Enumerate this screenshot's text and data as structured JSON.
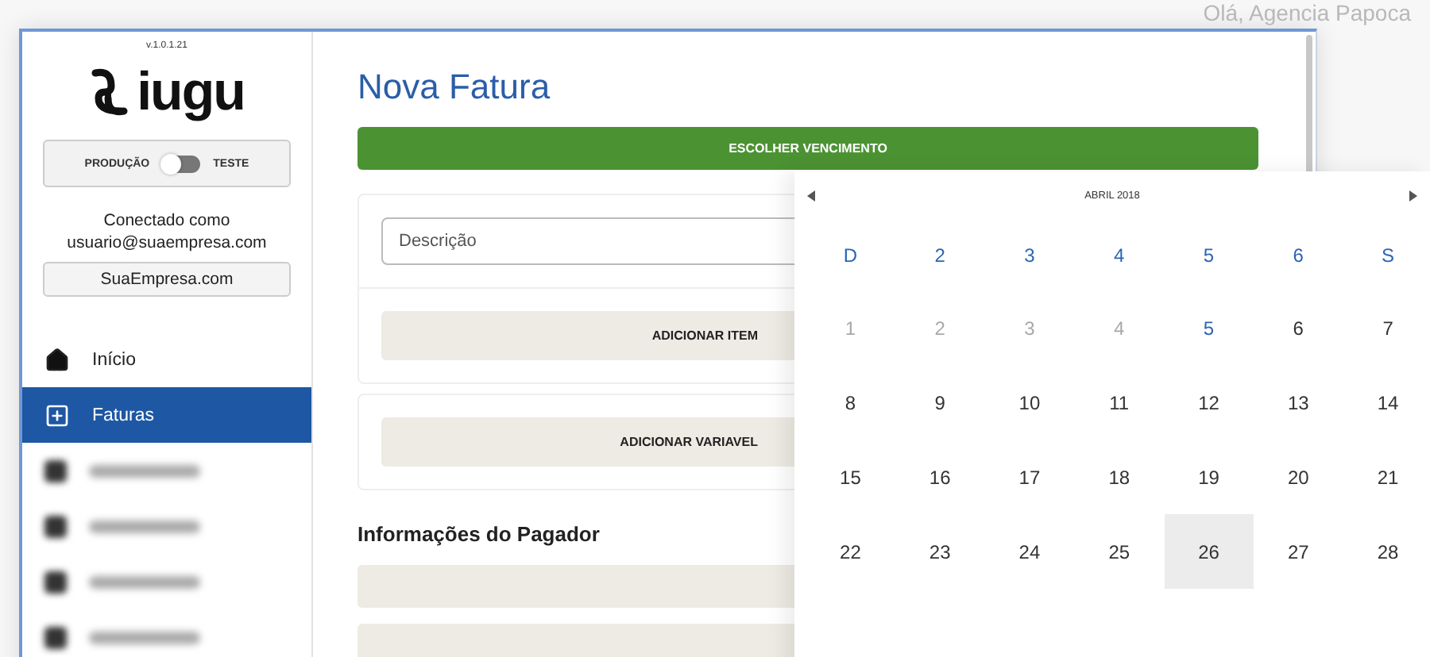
{
  "greeting": "Olá, Agencia Papoca",
  "sidebar": {
    "version": "v.1.0.1.21",
    "logo": "iugu",
    "mode_toggle": {
      "left_label": "PRODUÇÃO",
      "right_label": "TESTE",
      "on": false
    },
    "connected_label": "Conectado como",
    "email": "usuario@suaempresa.com",
    "company": "SuaEmpresa.com",
    "items": [
      {
        "kind": "home",
        "label": "Início",
        "selected": false
      },
      {
        "kind": "invoice",
        "label": "Faturas",
        "selected": true
      },
      {
        "kind": "blurred",
        "selected": false
      },
      {
        "kind": "blurred",
        "selected": false
      },
      {
        "kind": "blurred",
        "selected": false
      },
      {
        "kind": "blurred",
        "selected": false
      }
    ]
  },
  "main": {
    "title": "Nova Fatura",
    "due_button": "ESCOLHER VENCIMENTO",
    "item": {
      "description_placeholder": "Descrição"
    },
    "add_item_button": "ADICIONAR ITEM",
    "add_variable_button": "ADICIONAR VARIAVEL",
    "payer_heading": "Informações do Pagador"
  },
  "calendar": {
    "month": "ABRIL 2018",
    "weekdays": [
      "D",
      "2",
      "3",
      "4",
      "5",
      "6",
      "S"
    ],
    "weeks": [
      [
        {
          "label": "1",
          "kind": "disabled",
          "selected": false
        },
        {
          "label": "2",
          "kind": "disabled",
          "selected": false
        },
        {
          "label": "3",
          "kind": "disabled",
          "selected": false
        },
        {
          "label": "4",
          "kind": "disabled",
          "selected": false
        },
        {
          "label": "5",
          "kind": "today",
          "selected": false
        },
        {
          "label": "6",
          "kind": "normal",
          "selected": false
        },
        {
          "label": "7",
          "kind": "normal",
          "selected": false
        }
      ],
      [
        {
          "label": "8",
          "kind": "normal",
          "selected": false
        },
        {
          "label": "9",
          "kind": "normal",
          "selected": false
        },
        {
          "label": "10",
          "kind": "normal",
          "selected": false
        },
        {
          "label": "11",
          "kind": "normal",
          "selected": false
        },
        {
          "label": "12",
          "kind": "normal",
          "selected": false
        },
        {
          "label": "13",
          "kind": "normal",
          "selected": false
        },
        {
          "label": "14",
          "kind": "normal",
          "selected": false
        }
      ],
      [
        {
          "label": "15",
          "kind": "normal",
          "selected": false
        },
        {
          "label": "16",
          "kind": "normal",
          "selected": false
        },
        {
          "label": "17",
          "kind": "normal",
          "selected": false
        },
        {
          "label": "18",
          "kind": "normal",
          "selected": false
        },
        {
          "label": "19",
          "kind": "normal",
          "selected": false
        },
        {
          "label": "20",
          "kind": "normal",
          "selected": false
        },
        {
          "label": "21",
          "kind": "normal",
          "selected": false
        }
      ],
      [
        {
          "label": "22",
          "kind": "normal",
          "selected": false
        },
        {
          "label": "23",
          "kind": "normal",
          "selected": false
        },
        {
          "label": "24",
          "kind": "normal",
          "selected": false
        },
        {
          "label": "25",
          "kind": "normal",
          "selected": false
        },
        {
          "label": "26",
          "kind": "normal",
          "selected": true
        },
        {
          "label": "27",
          "kind": "normal",
          "selected": false
        },
        {
          "label": "28",
          "kind": "normal",
          "selected": false
        }
      ]
    ]
  }
}
